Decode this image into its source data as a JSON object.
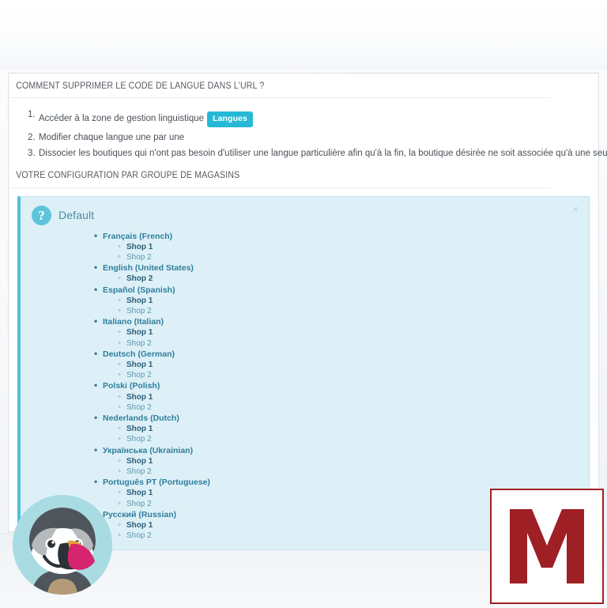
{
  "card": {
    "title": "COMMENT SUPPRIMER LE CODE DE LANGUE DANS L'URL ?",
    "section_title": "VOTRE CONFIGURATION PAR GROUPE DE MAGASINS",
    "steps": [
      {
        "num": "1.",
        "text": "Accéder à la zone de gestion linguistique",
        "badge": "Langues"
      },
      {
        "num": "2.",
        "text": "Modifier chaque langue une par une",
        "badge": null
      },
      {
        "num": "3.",
        "text": "Dissocier les boutiques qui n'ont pas besoin d'utiliser une langue particulière afin qu'à la fin, la boutique désirée ne soit associée qu'à une seule langue.",
        "badge": null
      }
    ]
  },
  "alert": {
    "icon": "question-mark-icon",
    "title": "Default",
    "close_label": "×",
    "languages": [
      {
        "name": "Français (French)",
        "shops": [
          {
            "label": "Shop 1",
            "assigned": true
          },
          {
            "label": "Shop 2",
            "assigned": false
          }
        ]
      },
      {
        "name": "English (United States)",
        "shops": [
          {
            "label": "Shop 2",
            "assigned": true
          }
        ]
      },
      {
        "name": "Español (Spanish)",
        "shops": [
          {
            "label": "Shop 1",
            "assigned": true
          },
          {
            "label": "Shop 2",
            "assigned": false
          }
        ]
      },
      {
        "name": "Italiano (Italian)",
        "shops": [
          {
            "label": "Shop 1",
            "assigned": true
          },
          {
            "label": "Shop 2",
            "assigned": false
          }
        ]
      },
      {
        "name": "Deutsch (German)",
        "shops": [
          {
            "label": "Shop 1",
            "assigned": true
          },
          {
            "label": "Shop 2",
            "assigned": false
          }
        ]
      },
      {
        "name": "Polski (Polish)",
        "shops": [
          {
            "label": "Shop 1",
            "assigned": true
          },
          {
            "label": "Shop 2",
            "assigned": false
          }
        ]
      },
      {
        "name": "Nederlands (Dutch)",
        "shops": [
          {
            "label": "Shop 1",
            "assigned": true
          },
          {
            "label": "Shop 2",
            "assigned": false
          }
        ]
      },
      {
        "name": "Українська (Ukrainian)",
        "shops": [
          {
            "label": "Shop 1",
            "assigned": true
          },
          {
            "label": "Shop 2",
            "assigned": false
          }
        ]
      },
      {
        "name": "Português PT (Portuguese)",
        "shops": [
          {
            "label": "Shop 1",
            "assigned": true
          },
          {
            "label": "Shop 2",
            "assigned": false
          }
        ]
      },
      {
        "name": "Русский (Russian)",
        "shops": [
          {
            "label": "Shop 1",
            "assigned": true
          },
          {
            "label": "Shop 2",
            "assigned": false
          }
        ]
      }
    ]
  },
  "branding": {
    "mascot_name": "prestashop-puffin-mascot",
    "logo_letter": "M"
  },
  "colors": {
    "accent_cyan": "#25b9d7",
    "alert_bg": "#ddf0f7",
    "alert_border_left": "#52bfd8",
    "lang_text": "#2e7e9c",
    "shop_text": "#5b97ac",
    "logo_red": "#9e1f24",
    "mascot_circle": "#a9dbe2"
  }
}
